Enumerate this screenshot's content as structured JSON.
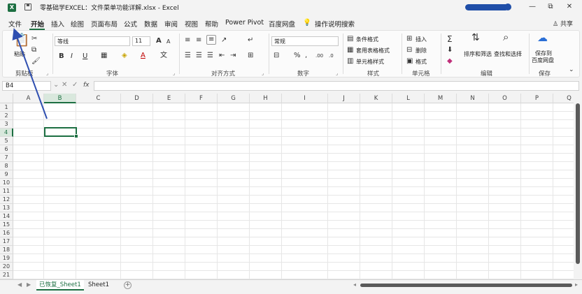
{
  "titlebar": {
    "app_logo": "X",
    "title": "零基础学EXCEL：文件菜单功能详解.xlsx  -  Excel",
    "minimize": "—",
    "restore": "⧉",
    "close": "✕"
  },
  "tabs": {
    "file": "文件",
    "home": "开始",
    "insert": "插入",
    "draw": "绘图",
    "layout": "页面布局",
    "formulas": "公式",
    "data": "数据",
    "review": "审阅",
    "view": "视图",
    "help": "帮助",
    "powerpivot": "Power Pivot",
    "baidu": "百度网盘",
    "tell_me": "操作说明搜索",
    "share": "共享"
  },
  "ribbon": {
    "clipboard": {
      "label": "剪贴板",
      "paste": "粘贴"
    },
    "font": {
      "label": "字体",
      "name": "等线",
      "size": "11",
      "bold": "B",
      "italic": "I",
      "underline": "U",
      "grow": "A",
      "shrink": "A"
    },
    "alignment": {
      "label": "对齐方式"
    },
    "number": {
      "label": "数字",
      "format": "常规",
      "percent": "%"
    },
    "styles": {
      "label": "样式",
      "conditional": "条件格式",
      "table": "套用表格格式",
      "cell_styles": "单元格样式"
    },
    "cells": {
      "label": "单元格",
      "insert": "插入",
      "delete": "删除",
      "format": "格式"
    },
    "editing": {
      "label": "编辑",
      "sort": "排序和筛选",
      "find": "查找和选择"
    },
    "save": {
      "label": "保存",
      "save_to": "保存到",
      "baidu": "百度网盘"
    }
  },
  "formula_bar": {
    "name_box": "B4",
    "fx": "fx",
    "value": ""
  },
  "grid": {
    "columns": [
      "A",
      "B",
      "C",
      "D",
      "E",
      "F",
      "G",
      "H",
      "I",
      "J",
      "K",
      "L",
      "M",
      "N",
      "O",
      "P",
      "Q"
    ],
    "rows": [
      "1",
      "2",
      "3",
      "4",
      "5",
      "6",
      "7",
      "8",
      "9",
      "10",
      "11",
      "12",
      "13",
      "14",
      "15",
      "16",
      "17",
      "18",
      "19",
      "20",
      "21"
    ],
    "active_cell": "B4"
  },
  "sheets": {
    "tabs": [
      "已恢复_Sheet1",
      "Sheet1"
    ],
    "active": "已恢复_Sheet1",
    "add": "+"
  }
}
